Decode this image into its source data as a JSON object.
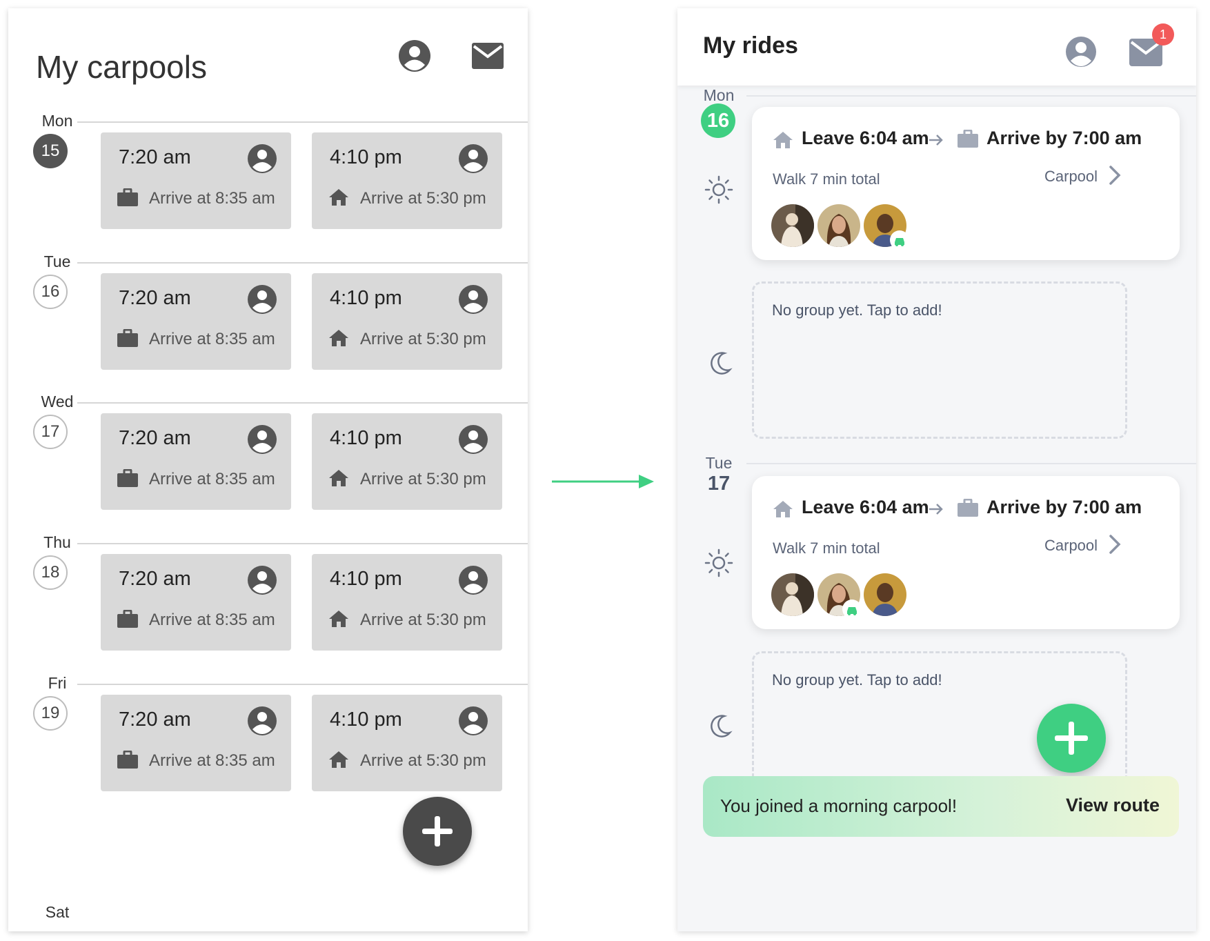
{
  "wireframe": {
    "title": "My carpools",
    "days": [
      {
        "name": "Mon",
        "num": "15",
        "active": true
      },
      {
        "name": "Tue",
        "num": "16",
        "active": false
      },
      {
        "name": "Wed",
        "num": "17",
        "active": false
      },
      {
        "name": "Thu",
        "num": "18",
        "active": false
      },
      {
        "name": "Fri",
        "num": "19",
        "active": false
      }
    ],
    "am_time": "7:20 am",
    "am_sub": "Arrive at 8:35 am",
    "pm_time": "4:10 pm",
    "pm_sub": "Arrive at 5:30 pm",
    "next_day": "Sat",
    "colors": {
      "card": "#d9d9d9",
      "fab": "#4a4a4a"
    }
  },
  "hifi": {
    "title": "My rides",
    "notification_count": "1",
    "mon": {
      "name": "Mon",
      "num": "16"
    },
    "tue": {
      "name": "Tue",
      "num": "17"
    },
    "ride": {
      "leave": "Leave 6:04 am",
      "arrive": "Arrive by 7:00 am",
      "walk": "Walk 7 min total",
      "type": "Carpool"
    },
    "empty_text": "No group yet. Tap to add!",
    "toast": {
      "message": "You joined a morning carpool!",
      "action": "View route"
    },
    "colors": {
      "accent": "#3fcf82",
      "badge": "#f25a5a",
      "text_muted": "#5b6478"
    }
  }
}
